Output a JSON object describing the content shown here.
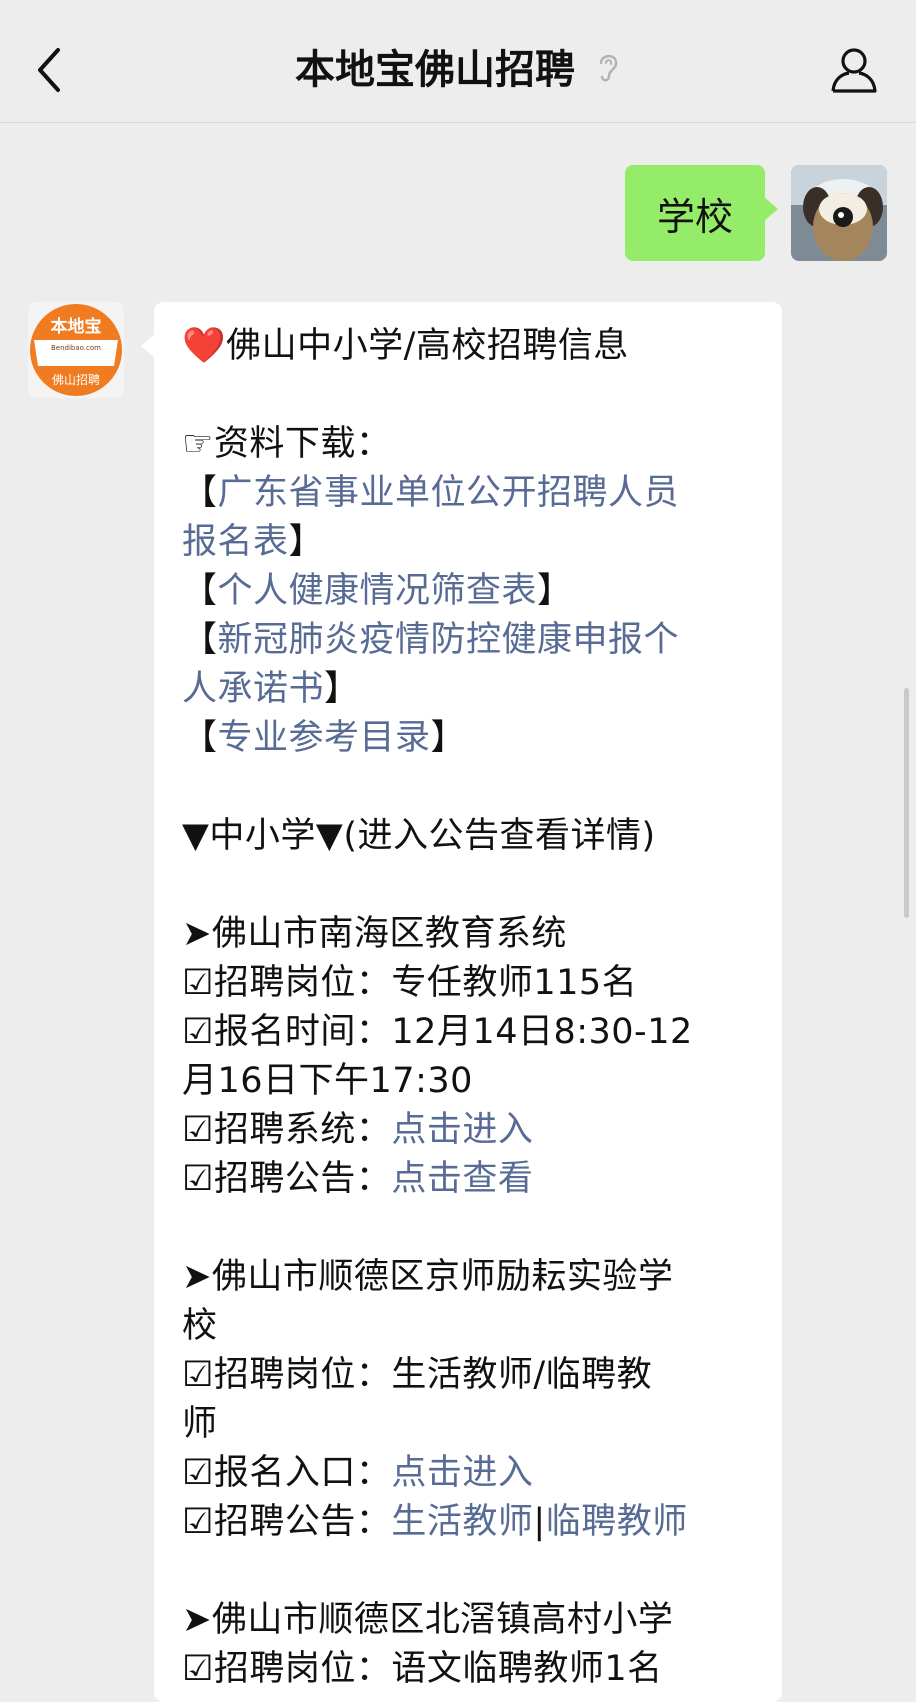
{
  "header": {
    "title": "本地宝佛山招聘"
  },
  "user_message": {
    "text": "学校"
  },
  "bot_avatar": {
    "logo_text": "本地宝",
    "logo_sub": "Bendibao.com",
    "logo_label": "佛山招聘",
    "brand_color": "#f07b20"
  },
  "message": {
    "heading": "佛山中小学/高校招聘信息",
    "download_label": "☞资料下载：",
    "downloads": [
      "广东省事业单位公开招聘人员",
      "报名表",
      "个人健康情况筛查表",
      "新冠肺炎疫情防控健康申报个",
      "人承诺书",
      "专业参考目录"
    ],
    "section_title": "▼中小学▼(进入公告查看详情)",
    "item1": {
      "title": "➤佛山市南海区教育系统",
      "pos_label": "☑招聘岗位：",
      "pos_value": "专任教师115名",
      "time_label": "☑报名时间：",
      "time_value_1": "12月14日8:30-12",
      "time_value_2": "月16日下午17:30",
      "sys_label": "☑招聘系统：",
      "sys_link": "点击进入",
      "notice_label": "☑招聘公告：",
      "notice_link": "点击查看"
    },
    "item2": {
      "title_1": "➤佛山市顺德区京师励耘实验学",
      "title_2": "校",
      "pos_label": "☑招聘岗位：",
      "pos_value_1": "生活教师/临聘教",
      "pos_value_2": "师",
      "entry_label": "☑报名入口：",
      "entry_link": "点击进入",
      "notice_label": "☑招聘公告：",
      "notice_link_1": "生活教师",
      "notice_sep": "|",
      "notice_link_2": "临聘教师"
    },
    "item3": {
      "title": "➤佛山市顺德区北滘镇高村小学",
      "pos_partial": "☑招聘岗位：语文临聘教师1名"
    }
  },
  "colors": {
    "link": "#576b95",
    "user_bubble": "#95ec69",
    "background": "#ededed"
  }
}
